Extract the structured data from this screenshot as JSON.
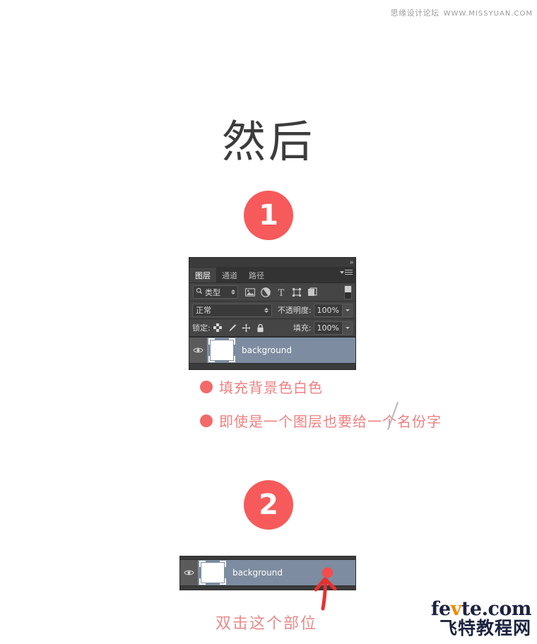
{
  "watermark": {
    "forum": "思缘设计论坛",
    "url": "WWW.MISSYUAN.COM"
  },
  "page": {
    "title": "然后"
  },
  "steps": [
    {
      "badge": "1"
    },
    {
      "badge": "2"
    }
  ],
  "ps_panel": {
    "collapse_icon": "»",
    "tabs": [
      {
        "label": "图层",
        "active": true
      },
      {
        "label": "通道",
        "active": false
      },
      {
        "label": "路径",
        "active": false
      }
    ],
    "menu_icon": "panel-menu-icon",
    "filter_row": {
      "search_icon": "search-icon",
      "filter_type_label": "类型",
      "icons": [
        {
          "name": "pixel-layer-filter-icon"
        },
        {
          "name": "adjustment-layer-filter-icon"
        },
        {
          "name": "type-layer-filter-icon"
        },
        {
          "name": "shape-layer-filter-icon"
        },
        {
          "name": "smart-object-filter-icon"
        }
      ],
      "toggle": "filter-enable-toggle"
    },
    "blend_row": {
      "blend_mode": "正常",
      "opacity_label": "不透明度:",
      "opacity_value": "100%"
    },
    "lock_row": {
      "lock_label": "锁定:",
      "lock_icons": [
        {
          "name": "lock-transparent-pixels-icon"
        },
        {
          "name": "lock-image-pixels-icon"
        },
        {
          "name": "lock-position-icon"
        },
        {
          "name": "lock-all-icon"
        }
      ],
      "fill_label": "填充:",
      "fill_value": "100%"
    },
    "layer": {
      "visibility_icon": "eye-icon",
      "thumbnail": "layer-thumbnail-white",
      "name": "background"
    }
  },
  "ps_strip": {
    "layer": {
      "visibility_icon": "eye-icon",
      "thumbnail": "layer-thumbnail-white",
      "name": "background"
    },
    "marker": "red-target-dot"
  },
  "notes": [
    {
      "text": "填充背景色白色"
    },
    {
      "text": "即使是一个图层也要给一个名份字"
    }
  ],
  "caption": "双击这个部位",
  "logo": {
    "en_before": "fe",
    "en_v": "v",
    "en_after": "te.com",
    "cn": "飞特教程网"
  },
  "colors": {
    "accent_red": "#f75a5a",
    "note_red": "#ef8080",
    "panel_bg": "#3b3b3b",
    "panel_row_bg": "#454545",
    "layer_selected": "#7d8ca0",
    "logo_navy": "#1c2340",
    "logo_orange": "#f08a00",
    "title_gray": "#3c3c3c"
  }
}
